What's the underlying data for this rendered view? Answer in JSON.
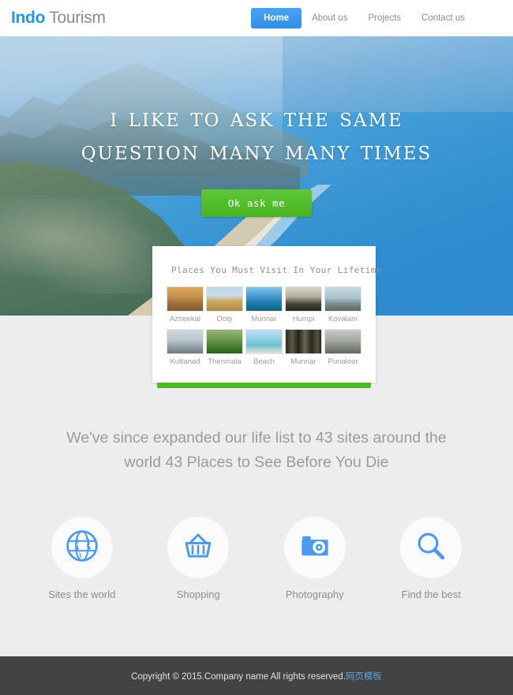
{
  "header": {
    "logo_primary": "Indo",
    "logo_secondary": "Tourism",
    "nav": [
      {
        "label": "Home",
        "active": true
      },
      {
        "label": "About us",
        "active": false
      },
      {
        "label": "Projects",
        "active": false
      },
      {
        "label": "Contact us",
        "active": false
      }
    ]
  },
  "hero": {
    "title": "I LIKE TO ASK THE SAME QUESTION MANY MANY TIMES",
    "button_label": "Ok ask me",
    "button_color": "#4cb821"
  },
  "card": {
    "title": "Places You Must Visit In Your Lifetime",
    "accent_color": "#4cb827",
    "thumbnails": [
      {
        "label": "Azheekal",
        "scene": "sunset-boat"
      },
      {
        "label": "Ooty",
        "scene": "road-field"
      },
      {
        "label": "Munnar",
        "scene": "blue-hills"
      },
      {
        "label": "Humpi",
        "scene": "stone-ruins"
      },
      {
        "label": "Kovalam",
        "scene": "rocky-shore"
      },
      {
        "label": "Kuttanad",
        "scene": "misty-backwater"
      },
      {
        "label": "Thenmala",
        "scene": "green-forest"
      },
      {
        "label": "Beach",
        "scene": "coast-beach"
      },
      {
        "label": "Munnar",
        "scene": "tall-trees"
      },
      {
        "label": "Punaloor",
        "scene": "grey-river"
      }
    ]
  },
  "subhead": {
    "text": "We've since expanded our life list to 43 sites around the world 43 Places to See Before You Die"
  },
  "features": [
    {
      "label": "Sites the world",
      "icon": "globe-icon"
    },
    {
      "label": "Shopping",
      "icon": "basket-icon"
    },
    {
      "label": "Photography",
      "icon": "camera-icon"
    },
    {
      "label": "Find the best",
      "icon": "magnifier-icon"
    }
  ],
  "footer": {
    "copyright": "Copyright © 2015.Company name All rights reserved.",
    "link_label": "网页模板",
    "link_color": "#5c9fd6"
  }
}
